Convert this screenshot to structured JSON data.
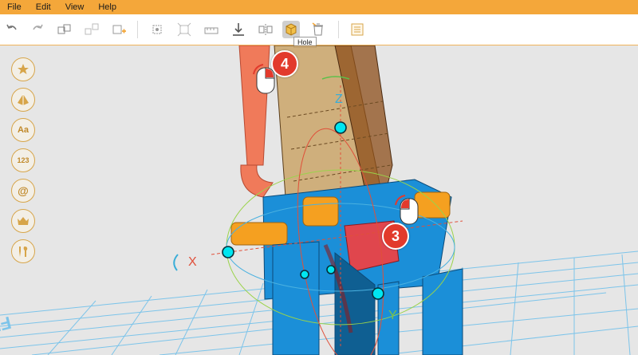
{
  "menu": {
    "file": "File",
    "edit": "Edit",
    "view": "View",
    "help": "Help"
  },
  "tooltip": {
    "hole": "Hole"
  },
  "sidebar": {
    "text_label": "Aa",
    "number_label": "123",
    "at_label": "@"
  },
  "viewport": {
    "axis_z": "Z",
    "axis_x": "X",
    "axis_y": "Y",
    "floor_text": "FRON",
    "step_badge_3": "3",
    "step_badge_4": "4"
  },
  "colors": {
    "accent": "#f4a73a",
    "gizmo_cyan": "#00e6f0",
    "part_blue": "#1b8fd8",
    "part_orange": "#f5a020",
    "part_red": "#e0464d",
    "hole_tan": "#c9a264",
    "badge_red": "#e23a2c"
  }
}
